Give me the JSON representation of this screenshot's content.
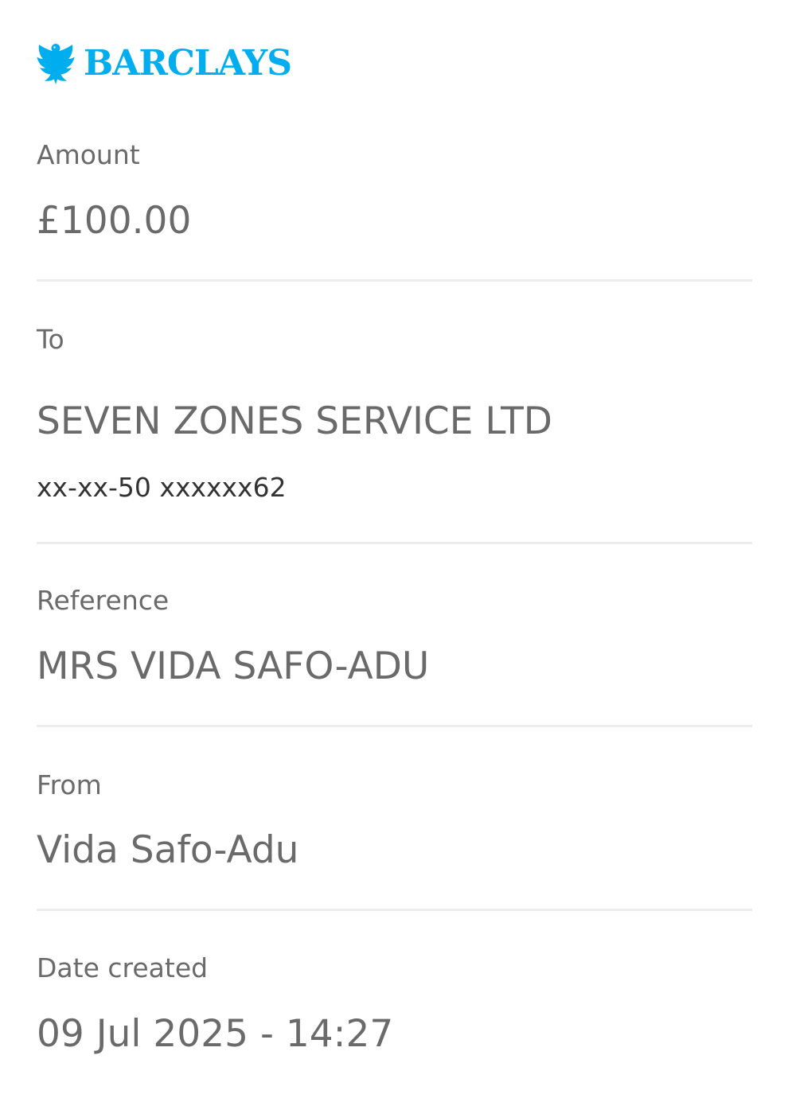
{
  "brand": {
    "name": "BARCLAYS",
    "logo_icon": "eagle-icon",
    "color": "#00aeef"
  },
  "amount": {
    "label": "Amount",
    "value": "£100.00"
  },
  "to": {
    "label": "To",
    "name": "SEVEN ZONES SERVICE LTD",
    "account": "xx-xx-50 xxxxxx62"
  },
  "reference": {
    "label": "Reference",
    "value": "MRS VIDA SAFO-ADU"
  },
  "from": {
    "label": "From",
    "value": "Vida Safo-Adu"
  },
  "date_created": {
    "label": "Date created",
    "value": "09 Jul 2025 - 14:27"
  }
}
